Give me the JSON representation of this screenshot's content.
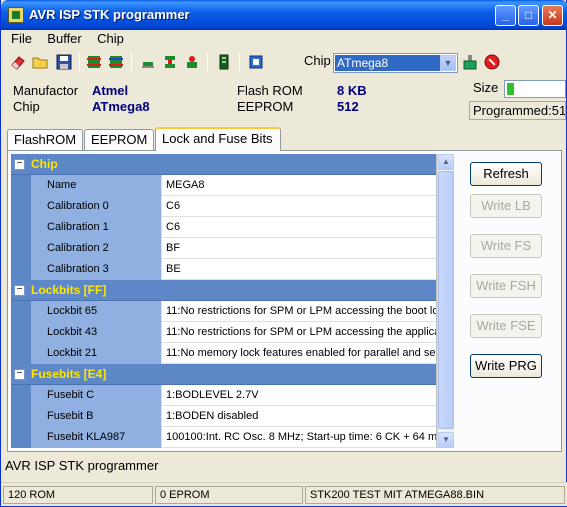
{
  "window": {
    "title": "AVR ISP STK programmer"
  },
  "menu": {
    "file": "File",
    "buffer": "Buffer",
    "chip": "Chip"
  },
  "toolbar": {
    "icons": [
      "eraser-icon",
      "open-folder-icon",
      "save-disk-icon",
      "chip-read-icon",
      "chip-write-icon",
      "chip-verify-icon",
      "chip-blank-icon",
      "chip-erase-icon",
      "memory-icon",
      "config-icon",
      "usb-icon",
      "stop-icon"
    ],
    "chip_label": "Chip",
    "chip_value": "ATmega8"
  },
  "chip_info": {
    "manufactor_label": "Manufactor",
    "manufactor_value": "Atmel",
    "chip_label": "Chip",
    "chip_value": "ATmega8",
    "flash_label": "Flash ROM",
    "flash_value": "8 KB",
    "eeprom_label": "EEPROM",
    "eeprom_value": "512"
  },
  "size": {
    "label": "Size",
    "progress_fraction": 0.12,
    "programmed": "Programmed:51"
  },
  "tabs": [
    "FlashROM",
    "EEPROM",
    "Lock and Fuse Bits"
  ],
  "active_tab": 2,
  "grid": {
    "chip": {
      "title": "Chip",
      "rows": [
        {
          "name": "Name",
          "value": "MEGA8"
        },
        {
          "name": "Calibration 0",
          "value": "C6"
        },
        {
          "name": "Calibration 1",
          "value": "C6"
        },
        {
          "name": "Calibration 2",
          "value": "BF"
        },
        {
          "name": "Calibration 3",
          "value": "BE"
        }
      ]
    },
    "lockbits": {
      "title": "Lockbits [FF]",
      "rows": [
        {
          "name": "Lockbit 65",
          "value": "11:No restrictions for SPM or LPM accessing the boot loa"
        },
        {
          "name": "Lockbit 43",
          "value": "11:No restrictions for SPM or LPM accessing the applicati"
        },
        {
          "name": "Lockbit 21",
          "value": "11:No memory lock features enabled for parallel and serial"
        }
      ]
    },
    "fusebits": {
      "title": "Fusebits [E4]",
      "rows": [
        {
          "name": "Fusebit C",
          "value": "1:BODLEVEL 2.7V"
        },
        {
          "name": "Fusebit B",
          "value": "1:BODEN disabled"
        },
        {
          "name": "Fusebit KLA987",
          "value": "100100:Int. RC Osc. 8 MHz; Start-up time: 6 CK + 64 ms;"
        }
      ]
    }
  },
  "buttons": {
    "refresh": "Refresh",
    "write_lb": "Write LB",
    "write_fs": "Write FS",
    "write_fsh": "Write FSH",
    "write_fse": "Write FSE",
    "write_prg": "Write PRG"
  },
  "status_message": "AVR ISP STK programmer",
  "statusbar": {
    "rom": "120 ROM",
    "eprom": "0 EPROM",
    "file": "STK200 TEST MIT ATMEGA88.BIN"
  }
}
